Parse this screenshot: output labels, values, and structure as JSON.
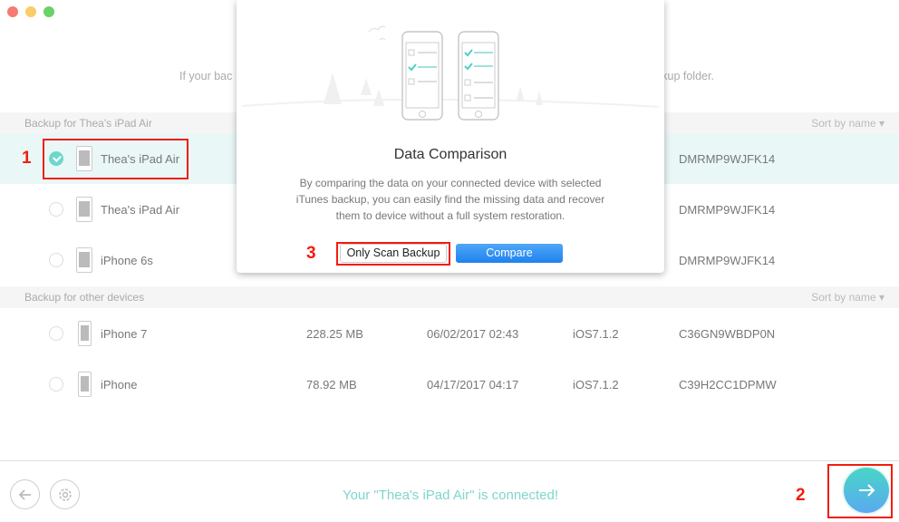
{
  "window": {
    "controls": [
      "close",
      "minimize",
      "zoom"
    ]
  },
  "hint": {
    "left_fragment": "If your bac",
    "right_fragment": "ckup folder."
  },
  "sections": [
    {
      "title": "Backup for Thea's iPad Air",
      "sort": "Sort by name"
    },
    {
      "title": "Backup for other devices",
      "sort": "Sort by name"
    }
  ],
  "rows": [
    {
      "name": "Thea's iPad Air",
      "type": "ipad",
      "selected": true,
      "size": "",
      "date": "",
      "ios": "",
      "serial": "DMRMP9WJFK14"
    },
    {
      "name": "Thea's iPad Air",
      "type": "ipad",
      "selected": false,
      "size": "",
      "date": "",
      "ios": "",
      "serial": "DMRMP9WJFK14"
    },
    {
      "name": "iPhone 6s",
      "type": "ipad",
      "selected": false,
      "size": "",
      "date": "",
      "ios": "",
      "serial": "DMRMP9WJFK14"
    },
    {
      "name": "iPhone 7",
      "type": "iphone",
      "selected": false,
      "size": "228.25 MB",
      "date": "06/02/2017 02:43",
      "ios": "iOS7.1.2",
      "serial": "C36GN9WBDP0N"
    },
    {
      "name": "iPhone",
      "type": "iphone",
      "selected": false,
      "size": "78.92 MB",
      "date": "04/17/2017 04:17",
      "ios": "iOS7.1.2",
      "serial": "C39H2CC1DPMW"
    }
  ],
  "modal": {
    "title": "Data Comparison",
    "description": [
      "By comparing the data on your connected device with selected",
      "iTunes backup, you can easily find the missing data and recover",
      "them to device without a full system restoration."
    ],
    "scan_label": "Only Scan Backup",
    "compare_label": "Compare"
  },
  "annotations": {
    "one": "1",
    "two": "2",
    "three": "3"
  },
  "footer": {
    "status": "Your \"Thea's iPad Air\" is connected!"
  },
  "colors": {
    "accent": "#6fd6cc",
    "status_text": "#7fd6cc",
    "compare_blue": "#2b8ef0",
    "annotation_red": "#f21c0d",
    "selected_row": "#eaf7f7"
  }
}
